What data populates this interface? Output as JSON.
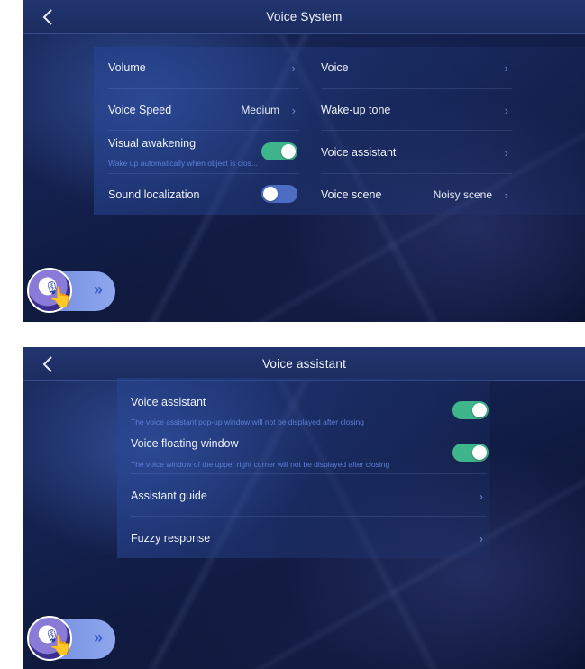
{
  "screen1": {
    "title": "Voice System",
    "rows": {
      "volume": "Volume",
      "voice": "Voice",
      "voice_speed": "Voice Speed",
      "voice_speed_value": "Medium",
      "wake_up_tone": "Wake-up tone",
      "visual_awakening": "Visual awakening",
      "visual_awakening_sub": "Wake up automatically when object is clos...",
      "voice_assistant": "Voice assistant",
      "sound_localization": "Sound localization",
      "voice_scene": "Voice scene",
      "voice_scene_value": "Noisy scene"
    },
    "toggles": {
      "visual_awakening": true,
      "sound_localization": false
    }
  },
  "screen2": {
    "title": "Voice assistant",
    "rows": {
      "voice_assistant": "Voice assistant",
      "voice_assistant_sub": "The voice assistant pop-up window will not be displayed after closing",
      "voice_floating_window": "Voice floating window",
      "voice_floating_window_sub": "The voice window of the upper right corner will not be displayed after closing",
      "assistant_guide": "Assistant guide",
      "fuzzy_response": "Fuzzy response"
    },
    "toggles": {
      "voice_assistant": true,
      "voice_floating_window": true
    }
  },
  "icons": {
    "back": "back-chevron-icon",
    "chevron": "chevron-right-icon",
    "voice_button": "voice-mic-hand-icon",
    "double_arrow": "double-chevron-right-icon"
  },
  "glyphs": {
    "chevron": "›",
    "double_chevron": "»",
    "mic": "🎙",
    "hand": "👆"
  },
  "colors": {
    "toggle_on": "#3fb58b",
    "toggle_off": "#4d6cc4",
    "subtext": "#5d7fd8",
    "accent_chevron": "#6b86d6"
  }
}
